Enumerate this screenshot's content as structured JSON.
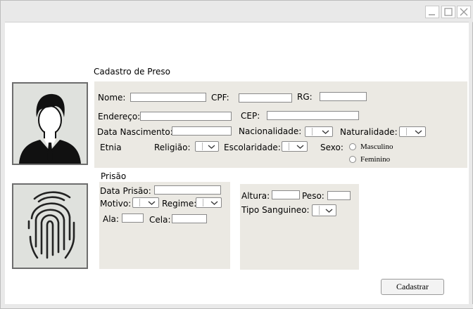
{
  "form": {
    "title": "Cadastro de Preso",
    "personal": {
      "nome_label": "Nome:",
      "cpf_label": "CPF:",
      "rg_label": "RG:",
      "endereco_label": "Endereço:",
      "cep_label": "CEP:",
      "data_nascimento_label": "Data Nascimento:",
      "nacionalidade_label": "Nacionalidade:",
      "naturalidade_label": "Naturalidade:",
      "etnia_label": "Etnia",
      "religiao_label": "Religião:",
      "escolaridade_label": "Escolaridade:",
      "sexo_label": "Sexo:",
      "sexo_options": [
        "Masculino",
        "Feminino"
      ]
    },
    "prisao": {
      "section_label": "Prisão",
      "data_prisao_label": "Data Prisão:",
      "motivo_label": "Motivo:",
      "regime_label": "Regime:",
      "ala_label": "Ala:",
      "cela_label": "Cela:",
      "altura_label": "Altura:",
      "peso_label": "Peso:",
      "tipo_sanguineo_label": "Tipo Sanguineo:"
    },
    "submit_label": "Cadastrar"
  },
  "colors": {
    "panel_bg": "#ebe9e3",
    "titlebar_bg": "#e9e9e9",
    "image_frame": "#6d6d6d"
  },
  "icons": [
    "person-silhouette-icon",
    "fingerprint-icon",
    "minimize-icon",
    "maximize-icon",
    "close-icon",
    "chevron-down-icon"
  ]
}
